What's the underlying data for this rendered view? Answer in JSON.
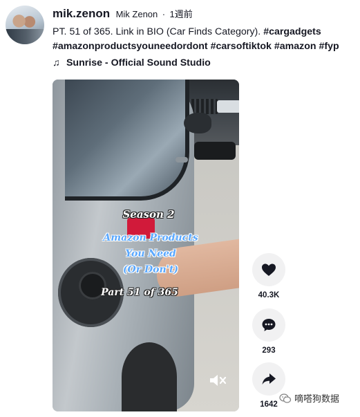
{
  "author": {
    "username": "mik.zenon",
    "nickname": "Mik Zenon",
    "separator": "·",
    "time": "1週前"
  },
  "caption": {
    "text": "PT. 51 of 365. Link in BIO (Car Finds Category).",
    "hashtags": [
      "#cargadgets",
      "#amazonproductsyouneedordont",
      "#carsoftiktok",
      "#amazon",
      "#fyp"
    ]
  },
  "music": {
    "icon": "music-note-icon",
    "glyph": "♫",
    "title": "Sunrise - Official Sound Studio"
  },
  "video": {
    "overlay": {
      "season": "Season 2",
      "line1": "Amazon Products",
      "line2": "You Need",
      "line3": "(Or Don't)",
      "part": "Part 51 of 365"
    },
    "mute_icon": "speaker-muted-icon"
  },
  "actions": {
    "like": {
      "icon": "heart-icon",
      "count": "40.3K"
    },
    "comment": {
      "icon": "comment-icon",
      "count": "293"
    },
    "share": {
      "icon": "share-icon",
      "count": "1642"
    }
  },
  "watermark": {
    "icon": "wechat-icon",
    "text": "嘀嗒狗数据"
  },
  "colors": {
    "text": "#161823",
    "action_bg": "#f1f1f2",
    "overlay_blue": "#5aa8ff"
  }
}
